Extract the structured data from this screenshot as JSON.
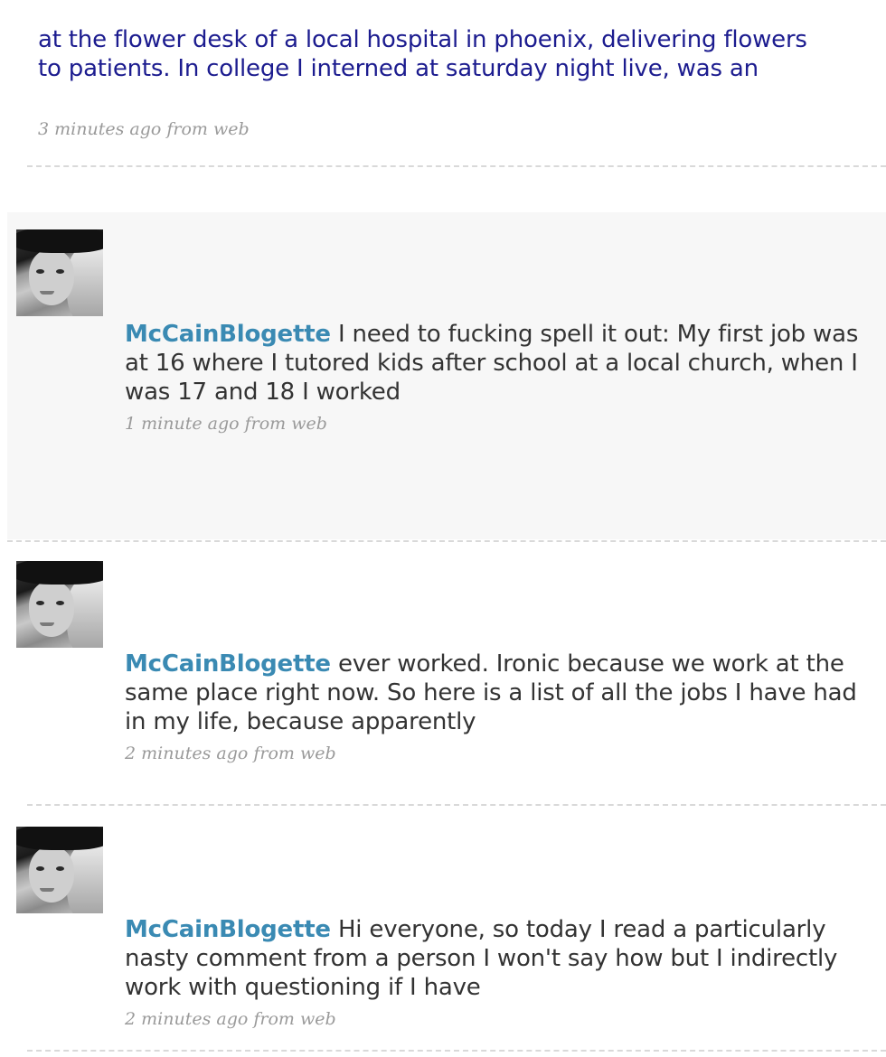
{
  "tweets": [
    {
      "username": "",
      "text": "at the flower desk of a local hospital in phoenix, delivering flowers to patients. In college I interned at saturday night live, was an",
      "time": "3 minutes ago",
      "source": "from web"
    },
    {
      "username": "McCainBlogette",
      "text": "I need to fucking spell it out: My first job was at 16 where I tutored kids after school at a local church, when I was 17 and 18 I worked",
      "time": "1 minute ago",
      "source": "from web"
    },
    {
      "username": "McCainBlogette",
      "text": "ever worked. Ironic because we work at the same place right now. So here is a list of all the jobs I have had in my life, because apparently",
      "time": "2 minutes ago",
      "source": "from web"
    },
    {
      "username": "McCainBlogette",
      "text": "Hi everyone, so today I read a particularly nasty comment from a person I won't say how but I indirectly work with questioning if I have",
      "time": "2 minutes ago",
      "source": "from web"
    }
  ],
  "colors": {
    "username": "#3a8ab3",
    "body_text": "#333333",
    "first_text": "#1c1c8f",
    "meta": "#9a9a9a",
    "highlight_bg": "#f7f7f7",
    "divider": "#d9d9d9"
  },
  "icons": {
    "avatar": "user-avatar-photo"
  }
}
